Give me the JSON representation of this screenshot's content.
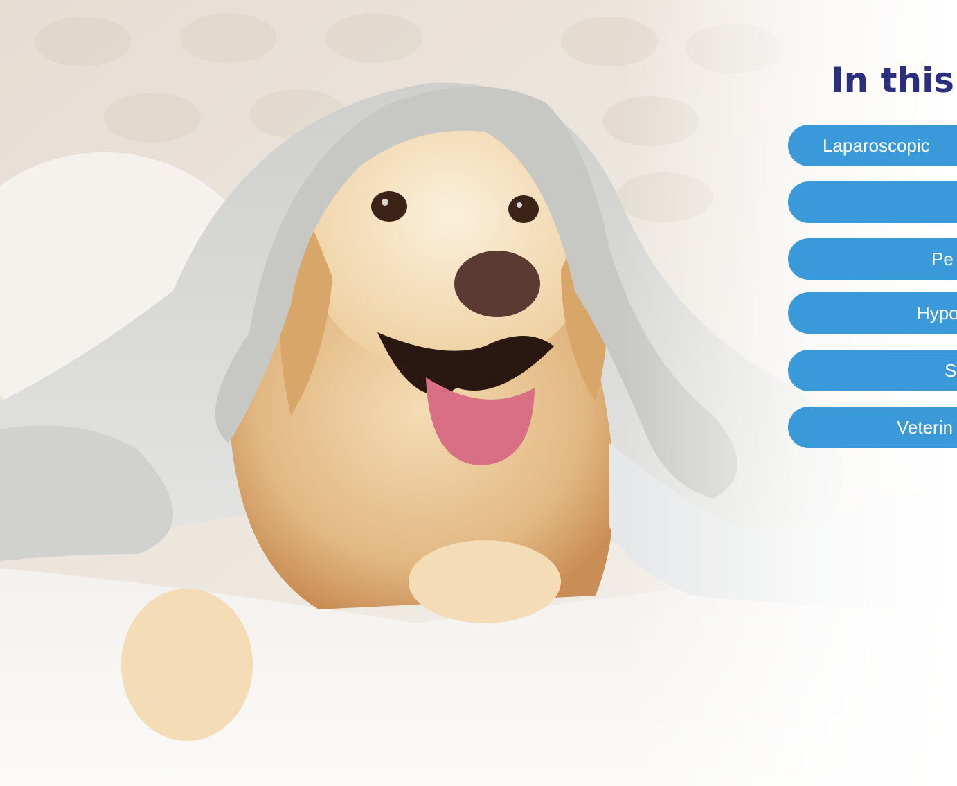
{
  "toc": {
    "heading": "In this",
    "items": [
      {
        "label": "Laparoscopic"
      },
      {
        "label": ""
      },
      {
        "label": "Pe"
      },
      {
        "label": "Hypo"
      },
      {
        "label": "S"
      },
      {
        "label": "Veterin"
      }
    ]
  },
  "colors": {
    "heading": "#2b2f7f",
    "pill": "#3a9ad9",
    "pill_text": "#ffffff"
  }
}
